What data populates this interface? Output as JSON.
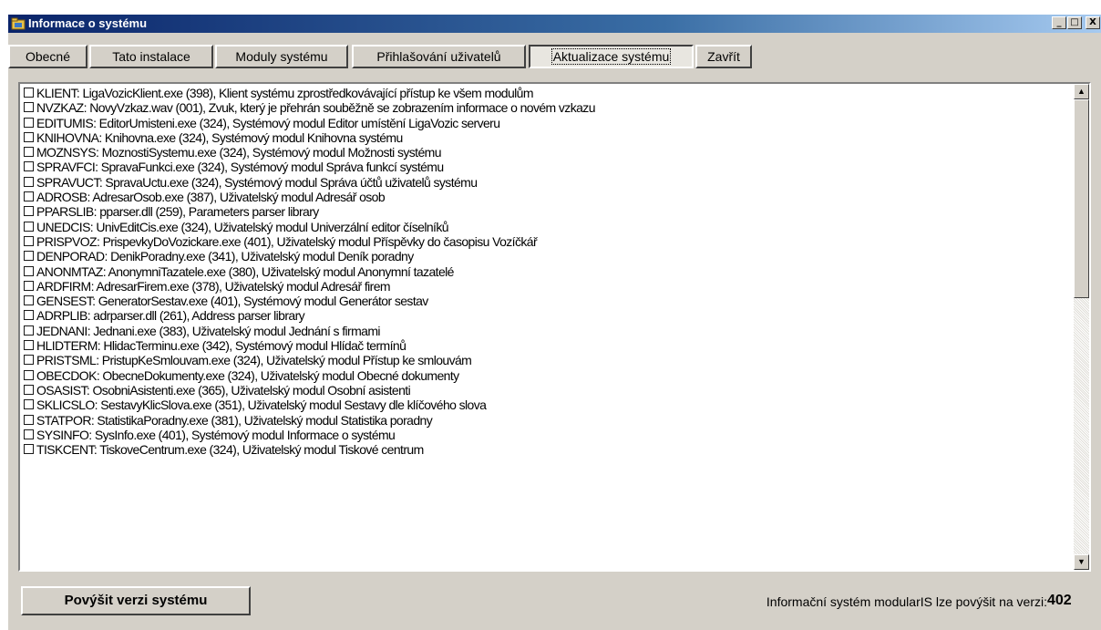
{
  "window": {
    "title": "Informace o systému",
    "icon": "folder-app-icon",
    "controls": {
      "minimize": "_",
      "maximize": "□",
      "close": "X"
    }
  },
  "tabs": [
    {
      "label": "Obecné"
    },
    {
      "label": "Tato instalace"
    },
    {
      "label": "Moduly systému"
    },
    {
      "label": "Přihlašování uživatelů"
    },
    {
      "label": "Aktualizace systému",
      "active": true
    },
    {
      "label": "Zavřít"
    }
  ],
  "modules": [
    "KLIENT: LigaVozicKlient.exe (398), Klient systému zprostředkovávající přístup ke všem modulům",
    "NVZKAZ: NovyVzkaz.wav (001), Zvuk, který je přehrán souběžně se zobrazením informace o novém vzkazu",
    "EDITUMIS: EditorUmisteni.exe (324), Systémový modul Editor umístění LigaVozic serveru",
    "KNIHOVNA: Knihovna.exe (324), Systémový modul Knihovna systému",
    "MOZNSYS: MoznostiSystemu.exe (324), Systémový modul Možnosti systému",
    "SPRAVFCI: SpravaFunkci.exe (324), Systémový modul Správa funkcí systému",
    "SPRAVUCT: SpravaUctu.exe (324), Systémový modul Správa účtů uživatelů systému",
    "ADROSB: AdresarOsob.exe (387), Uživatelský modul Adresář osob",
    "PPARSLIB: pparser.dll (259), Parameters parser library",
    "UNEDCIS: UnivEditCis.exe (324), Uživatelský modul Univerzální editor číselníků",
    "PRISPVOZ: PrispevkyDoVozickare.exe (401), Uživatelský modul Příspěvky do časopisu Vozíčkář",
    "DENPORAD: DenikPoradny.exe (341), Uživatelský modul Deník poradny",
    "ANONMTAZ: AnonymniTazatele.exe (380), Uživatelský modul Anonymní tazatelé",
    "ARDFIRM: AdresarFirem.exe (378), Uživatelský modul Adresář firem",
    "GENSEST: GeneratorSestav.exe (401), Systémový modul Generátor sestav",
    "ADRPLIB: adrparser.dll (261), Address parser library",
    "JEDNANI: Jednani.exe (383), Uživatelský modul Jednání s firmami",
    "HLIDTERM: HlidacTerminu.exe (342), Systémový modul Hlídač termínů",
    "PRISTSML: PristupKeSmlouvam.exe (324), Uživatelský modul Přístup ke smlouvám",
    "OBECDOK: ObecneDokumenty.exe (324), Uživatelský modul Obecné dokumenty",
    "OSASIST: OsobniAsistenti.exe (365), Uživatelský modul Osobní asistenti",
    "SKLICSLO: SestavyKlicSlova.exe (351), Uživatelský modul Sestavy dle klíčového slova",
    "STATPOR: StatistikaPoradny.exe (381), Uživatelský modul Statistika poradny",
    "SYSINFO: SysInfo.exe (401), Systémový modul Informace o systému",
    "TISKCENT: TiskoveCentrum.exe (324), Uživatelský modul Tiskové centrum"
  ],
  "footer": {
    "upgrade_button": "Povýšit verzi systému",
    "status_text": "Informační systém modularIS lze povýšit na verzi:",
    "version": "402"
  },
  "scrollbar": {
    "up": "▲",
    "down": "▼"
  },
  "colors": {
    "titlebar_start": "#0a246a",
    "titlebar_end": "#a6caf0",
    "face": "#d4d0c8"
  }
}
